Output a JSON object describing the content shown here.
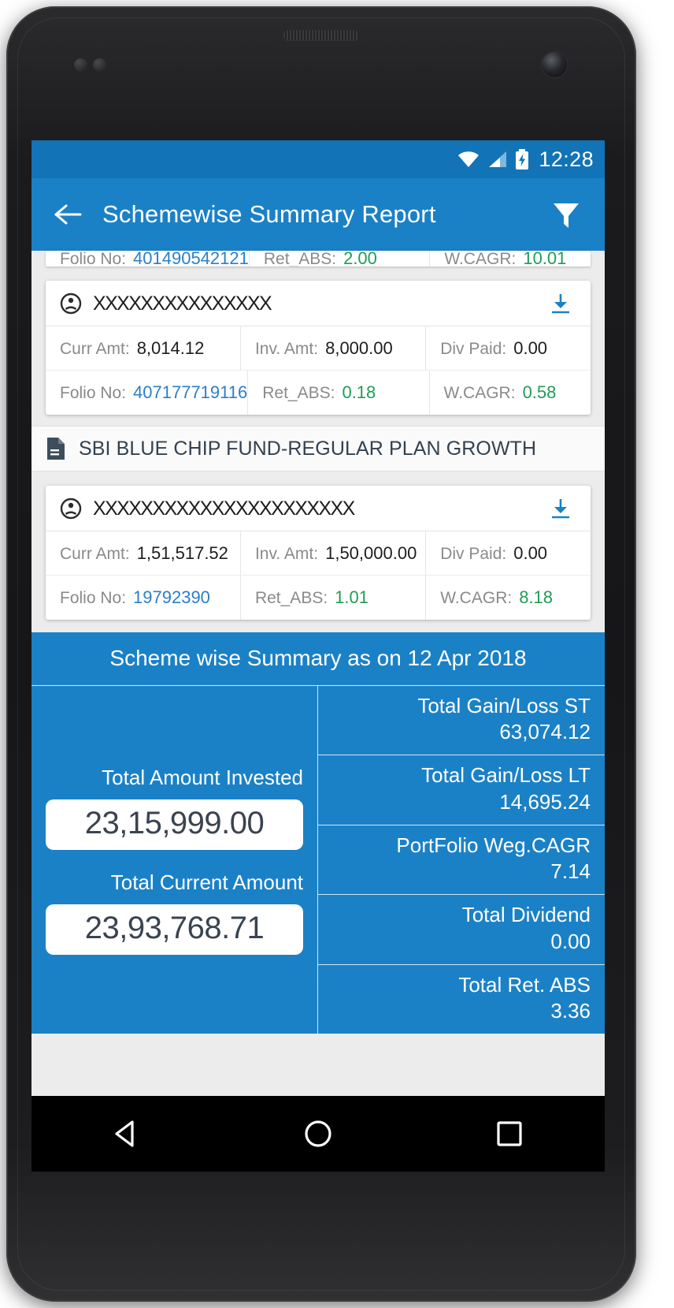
{
  "status_bar": {
    "time": "12:28",
    "icons": [
      "wifi-icon",
      "cellular-signal-icon",
      "battery-charging-icon"
    ]
  },
  "app_bar": {
    "back_icon": "arrow-left-icon",
    "title": "Schemewise Summary Report",
    "filter_icon": "filter-icon"
  },
  "clipped_card": {
    "folio_label": "Folio No:",
    "folio_value": "401490542121",
    "ret_label": "Ret_ABS:",
    "ret_value": "2.00",
    "cagr_label": "W.CAGR:",
    "cagr_value": "10.01"
  },
  "cards": [
    {
      "person_icon": "person-icon",
      "investor_name": "XXXXXXXXXXXXXXX",
      "download_icon": "download-icon",
      "curr_label": "Curr Amt:",
      "curr_value": "8,014.12",
      "inv_label": "Inv. Amt:",
      "inv_value": "8,000.00",
      "div_label": "Div Paid:",
      "div_value": "0.00",
      "folio_label": "Folio No:",
      "folio_value": "407177719116",
      "ret_label": "Ret_ABS:",
      "ret_value": "0.18",
      "cagr_label": "W.CAGR:",
      "cagr_value": "0.58"
    },
    {
      "person_icon": "person-icon",
      "investor_name": "XXXXXXXXXXXXXXXXXXXXXX",
      "download_icon": "download-icon",
      "curr_label": "Curr Amt:",
      "curr_value": "1,51,517.52",
      "inv_label": "Inv. Amt:",
      "inv_value": "1,50,000.00",
      "div_label": "Div Paid:",
      "div_value": "0.00",
      "folio_label": "Folio No:",
      "folio_value": "19792390",
      "ret_label": "Ret_ABS:",
      "ret_value": "1.01",
      "cagr_label": "W.CAGR:",
      "cagr_value": "8.18"
    }
  ],
  "scheme_header": {
    "icon": "document-icon",
    "title": "SBI BLUE CHIP FUND-REGULAR PLAN GROWTH"
  },
  "summary": {
    "title": "Scheme wise Summary as on 12 Apr 2018",
    "left": {
      "invested_label": "Total Amount Invested",
      "invested_value": "23,15,999.00",
      "current_label": "Total Current Amount",
      "current_value": "23,93,768.71"
    },
    "right_rows": [
      {
        "label": "Total Gain/Loss ST",
        "value": "63,074.12"
      },
      {
        "label": "Total Gain/Loss LT",
        "value": "14,695.24"
      },
      {
        "label": "PortFolio Weg.CAGR",
        "value": "7.14"
      },
      {
        "label": "Total Dividend",
        "value": "0.00"
      },
      {
        "label": "Total Ret. ABS",
        "value": "3.36"
      }
    ]
  },
  "nav_bar": {
    "back": "triangle-back-icon",
    "home": "circle-home-icon",
    "recents": "square-recents-icon"
  },
  "colors": {
    "primary": "#1b81c6",
    "status_bar": "#1273b6",
    "link": "#2a7fc9",
    "positive": "#1f9d55"
  }
}
